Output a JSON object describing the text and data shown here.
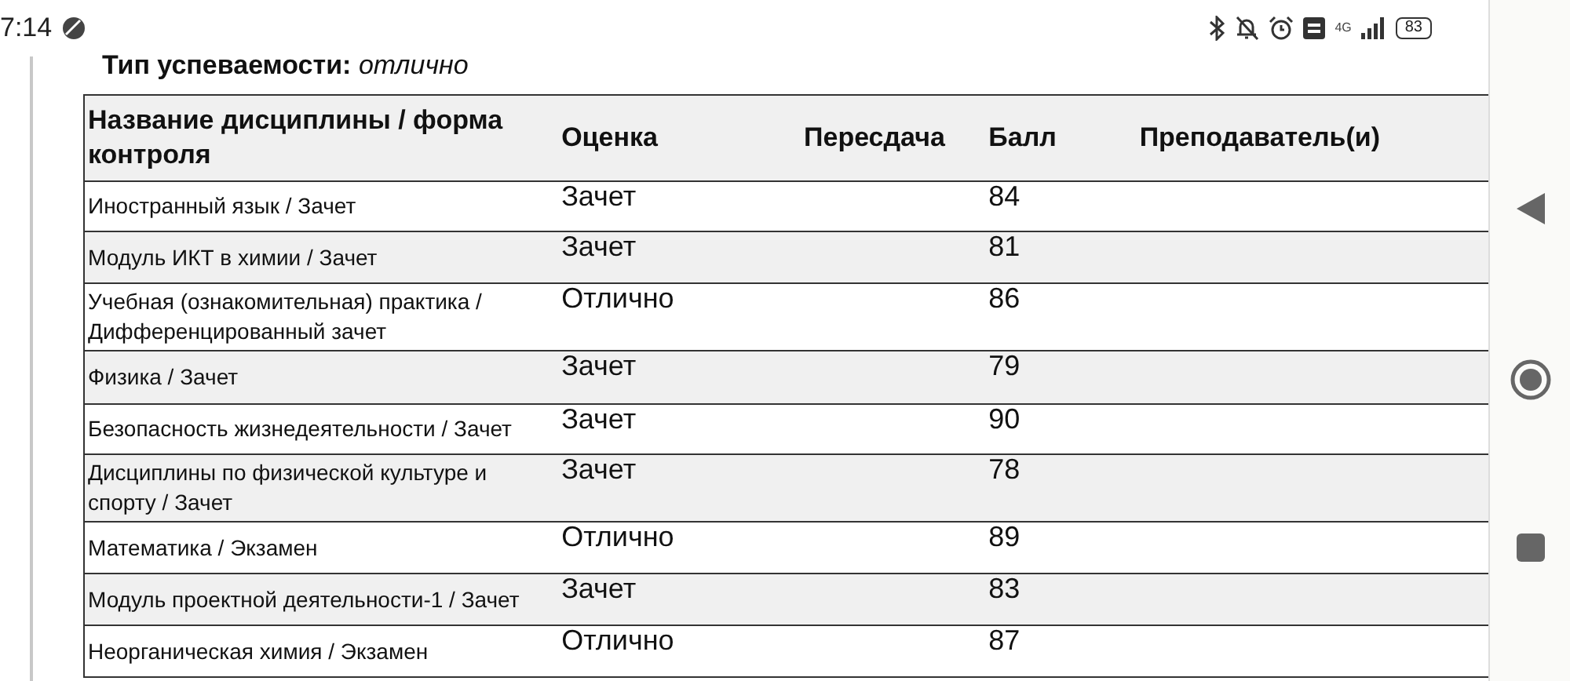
{
  "status_bar": {
    "time": "7:14",
    "network": "4G",
    "battery": "83"
  },
  "heading": "**Тип успеваемости:** *отлично*",
  "table": {
    "columns": [
      "Название дисциплины / форма контроля",
      "Оценка",
      "Пересдача",
      "Балл",
      "Преподаватель(и)"
    ],
    "rows": [
      {
        "discipline": "Иностранный язык / Зачет",
        "grade": "Зачет",
        "score": "84"
      },
      {
        "discipline": "Модуль ИКТ в химии / Зачет",
        "grade": "Зачет",
        "score": "81"
      },
      {
        "discipline": "Учебная (ознакомительная) практика / Дифференцированный зачет",
        "grade": "Отлично",
        "score": "86"
      },
      {
        "discipline": "Физика / Зачет",
        "grade": "Зачет",
        "score": "79"
      },
      {
        "discipline": "Безопасность жизнедеятельности / Зачет",
        "grade": "Зачет",
        "score": "90"
      },
      {
        "discipline": "Дисциплины по физической культуре и спорту / Зачет",
        "grade": "Зачет",
        "score": "78"
      },
      {
        "discipline": "Математика / Экзамен",
        "grade": "Отлично",
        "score": "89"
      },
      {
        "discipline": "Модуль проектной деятельности-1 / Зачет",
        "grade": "Зачет",
        "score": "83"
      },
      {
        "discipline": "Неорганическая химия / Экзамен",
        "grade": "Отлично",
        "score": "87"
      }
    ]
  }
}
